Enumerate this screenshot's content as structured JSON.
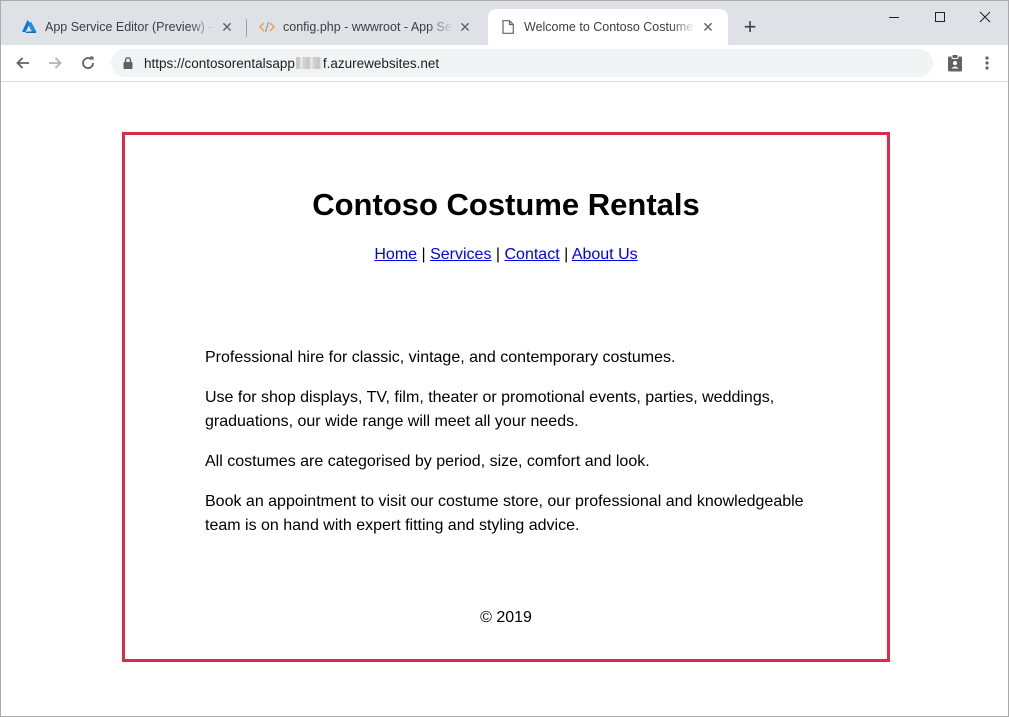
{
  "browser": {
    "tabs": [
      {
        "title": "App Service Editor (Preview) - Mo",
        "icon": "azure-logo-icon"
      },
      {
        "title": "config.php - wwwroot - App Servi",
        "icon": "code-file-icon"
      },
      {
        "title": "Welcome to Contoso Costume Re",
        "icon": "page-icon",
        "active": true
      }
    ],
    "new_tab_label": "+",
    "address": {
      "url_prefix": "https://contosorentalsapp",
      "url_suffix": "f.azurewebsites.net"
    },
    "colors": {
      "accent": "#1a73e8",
      "tabstrip": "#dee1e6",
      "highlight": "#dc2b47"
    }
  },
  "page": {
    "title": "Contoso Costume Rentals",
    "nav": {
      "home": "Home",
      "services": "Services",
      "contact": "Contact",
      "about": "About Us",
      "separator": " | "
    },
    "paragraphs": [
      "Professional hire for classic, vintage, and contemporary costumes.",
      "Use for shop displays, TV, film, theater or promotional events, parties, weddings, graduations, our wide range will meet all your needs.",
      "All costumes are categorised by period, size, comfort and look.",
      "Book an appointment to visit our costume store, our professional and knowledgeable team is on hand with expert fitting and styling advice."
    ],
    "footer": "© 2019"
  }
}
